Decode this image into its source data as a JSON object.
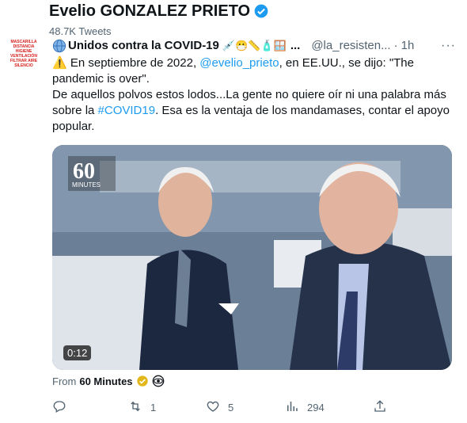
{
  "profile": {
    "name": "Evelio GONZALEZ PRIETO",
    "tweet_count": "48.7K Tweets",
    "avatar_lines": [
      "MASCARILLA",
      "DISTANCIA",
      "HIGIENE",
      "VENTILACIÓN",
      "FILTRAR AIRE",
      "SILENCIO"
    ]
  },
  "tweet": {
    "author": "Unidos contra la COVID-19",
    "author_emojis": "💉😷📏🧴🪟",
    "ellipsis": "...",
    "handle": "@la_resisten...",
    "separator": "·",
    "time": "1h",
    "more": "···",
    "text_1": "⚠️ En septiembre de 2022, ",
    "mention": "@evelio_prieto",
    "text_2": ", en EE.UU., se dijo: \"The pandemic is over\".\nDe aquellos polvos estos lodos...La gente no quiere oír ni una palabra más sobre la ",
    "hashtag": "#COVID19",
    "text_3": ". Esa es la ventaja de los mandamases, contar el apoyo popular."
  },
  "media": {
    "duration": "0:12",
    "badge_big": "60",
    "badge_small": "MINUTES"
  },
  "source": {
    "prefix": "From",
    "name": "60 Minutes"
  },
  "actions": {
    "replies": "",
    "retweets": "1",
    "likes": "5",
    "views": "294"
  },
  "colors": {
    "link": "#1d9bf0",
    "verified": "#1d9bf0",
    "muted": "#536471"
  }
}
